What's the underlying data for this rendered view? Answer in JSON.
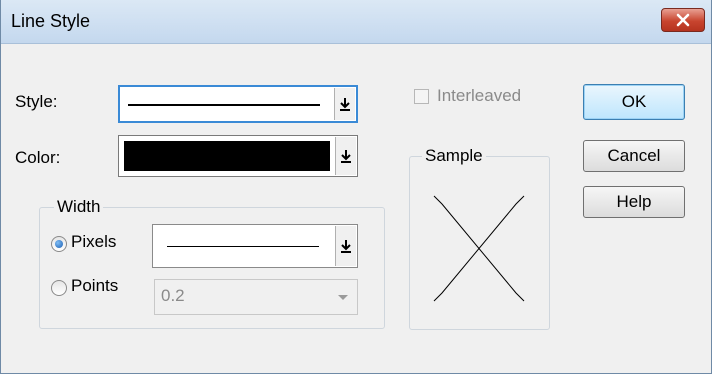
{
  "window": {
    "title": "Line Style"
  },
  "style_row": {
    "label": "Style:"
  },
  "color_row": {
    "label": "Color:",
    "value_color": "#000000"
  },
  "interleaved": {
    "label": "Interleaved",
    "checked": false
  },
  "sample": {
    "legend": "Sample"
  },
  "width_group": {
    "legend": "Width",
    "pixels": {
      "label": "Pixels",
      "selected": true
    },
    "points": {
      "label": "Points",
      "selected": false,
      "value": "0.2"
    }
  },
  "buttons": {
    "ok": "OK",
    "cancel": "Cancel",
    "help": "Help"
  },
  "icons": {
    "close": "close-icon",
    "dropdown": "dropdown-arrow-icon"
  }
}
